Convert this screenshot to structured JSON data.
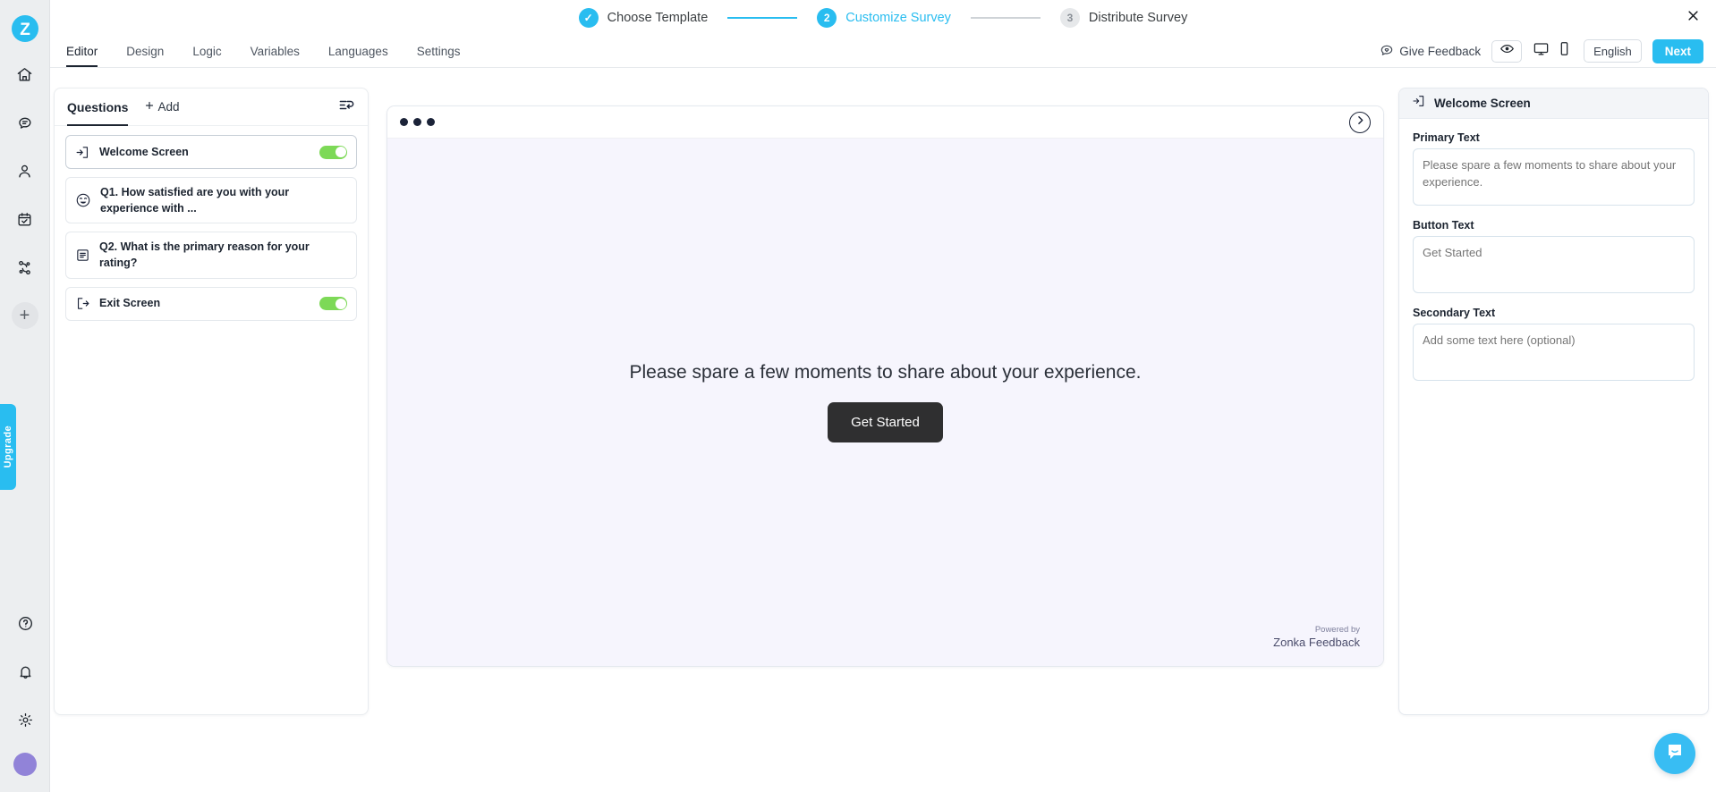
{
  "brand": {
    "logo_letter": "Z",
    "accent": "#29bdf0",
    "upgrade_label": "Upgrade"
  },
  "rail": {
    "items": [
      {
        "name": "home-icon"
      },
      {
        "name": "chat-icon"
      },
      {
        "name": "contacts-icon"
      },
      {
        "name": "tasks-icon"
      },
      {
        "name": "workflow-icon"
      }
    ],
    "add_label": "+",
    "bottom": [
      {
        "name": "help-icon"
      },
      {
        "name": "bell-icon"
      },
      {
        "name": "gear-icon"
      }
    ]
  },
  "stepper": {
    "steps": [
      {
        "badge": "✓",
        "label": "Choose Template",
        "state": "done"
      },
      {
        "badge": "2",
        "label": "Customize Survey",
        "state": "current"
      },
      {
        "badge": "3",
        "label": "Distribute Survey",
        "state": "todo"
      }
    ]
  },
  "tabs": [
    {
      "label": "Editor",
      "active": true
    },
    {
      "label": "Design",
      "active": false
    },
    {
      "label": "Logic",
      "active": false
    },
    {
      "label": "Variables",
      "active": false
    },
    {
      "label": "Languages",
      "active": false
    },
    {
      "label": "Settings",
      "active": false
    }
  ],
  "toolbar": {
    "give_feedback": "Give Feedback",
    "language": "English",
    "next_label": "Next"
  },
  "questions_panel": {
    "title": "Questions",
    "add_label": "Add",
    "items": [
      {
        "label": "Welcome Screen",
        "icon": "enter-door-icon",
        "toggle": true,
        "selected": true
      },
      {
        "label": "Q1. How satisfied are you with your experience with ...",
        "icon": "emoji-smiley-icon",
        "toggle": false,
        "selected": false
      },
      {
        "label": "Q2. What is the primary reason for your rating?",
        "icon": "text-lines-icon",
        "toggle": false,
        "selected": false
      },
      {
        "label": "Exit Screen",
        "icon": "exit-door-icon",
        "toggle": true,
        "selected": false
      }
    ]
  },
  "preview": {
    "primary_text": "Please spare a few moments to share about your experience.",
    "button_label": "Get Started",
    "powered_by": "Powered by",
    "brand_name": "Zonka Feedback"
  },
  "properties": {
    "header": "Welcome Screen",
    "primary_text": {
      "label": "Primary Text",
      "placeholder": "Please spare a few moments to share about your experience."
    },
    "button_text": {
      "label": "Button Text",
      "placeholder": "Get Started"
    },
    "secondary_text": {
      "label": "Secondary Text",
      "placeholder": "Add some text here (optional)"
    }
  }
}
